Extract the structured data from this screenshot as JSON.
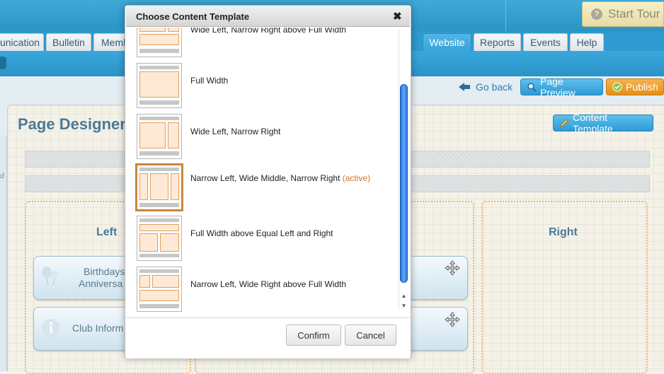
{
  "header": {
    "start_tour_label": "Start Tour",
    "help_glyph": "?"
  },
  "nav": {
    "tabs": [
      {
        "label": "unication"
      },
      {
        "label": "Bulletin"
      },
      {
        "label": "Memb"
      },
      {
        "label": "Website",
        "active": true
      },
      {
        "label": "Reports"
      },
      {
        "label": "Events"
      },
      {
        "label": "Help"
      }
    ]
  },
  "toolbar": {
    "go_back_label": "Go back",
    "page_preview_label": "Page Preview",
    "publish_label": "Publish",
    "content_template_label": "Content Template"
  },
  "page": {
    "title": "Page Designer:",
    "left_strip_glyph": "d",
    "columns": {
      "left_header": "Left",
      "right_header": "Right"
    },
    "widgets": {
      "birthdays_line1": "Birthdays",
      "birthdays_line2": "Anniversa",
      "club_info": "Club Inform"
    }
  },
  "modal": {
    "title": "Choose Content Template",
    "close_glyph": "✖",
    "templates": [
      {
        "label": "Wide Left, Narrow Right above Full Width"
      },
      {
        "label": "Full Width"
      },
      {
        "label": "Wide Left, Narrow Right"
      },
      {
        "label": "Narrow Left, Wide Middle, Narrow Right",
        "active_tag": "(active)"
      },
      {
        "label": "Full Width above Equal Left and Right"
      },
      {
        "label": "Narrow Left, Wide Right above Full Width"
      }
    ],
    "confirm_label": "Confirm",
    "cancel_label": "Cancel"
  },
  "colors": {
    "top_bar": "#3fa9d8",
    "active_tab": "#3aa4d8",
    "publish": "#e58f1b",
    "active_template_border": "#c7883a",
    "active_tag": "#d4731f",
    "scrollbar": "#2a77dd"
  },
  "icons": [
    "help-icon",
    "back-arrow-icon",
    "magnifier-icon",
    "check-icon",
    "pencil-icon",
    "balloons-icon",
    "info-icon",
    "move-icon",
    "close-icon",
    "scroll-up-icon",
    "scroll-down-icon"
  ]
}
